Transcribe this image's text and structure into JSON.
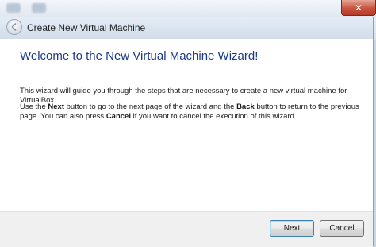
{
  "window": {
    "title": "Create New Virtual Machine",
    "close_glyph": "✕"
  },
  "wizard": {
    "heading": "Welcome to the New Virtual Machine Wizard!",
    "paragraph1": "This wizard will guide you through the steps that are necessary to create a new virtual machine for VirtualBox.",
    "paragraph2": {
      "t1": "Use the ",
      "next_word": "Next",
      "t2": " button to go to the next page of the wizard and the ",
      "back_word": "Back",
      "t3": " button to return to the previous page. You can also press ",
      "cancel_word": "Cancel",
      "t4": " if you want to cancel the execution of this wizard."
    }
  },
  "buttons": {
    "next_label": "Next",
    "cancel_label": "Cancel"
  },
  "icons": {
    "back": "back-arrow-icon",
    "close": "close-icon"
  }
}
